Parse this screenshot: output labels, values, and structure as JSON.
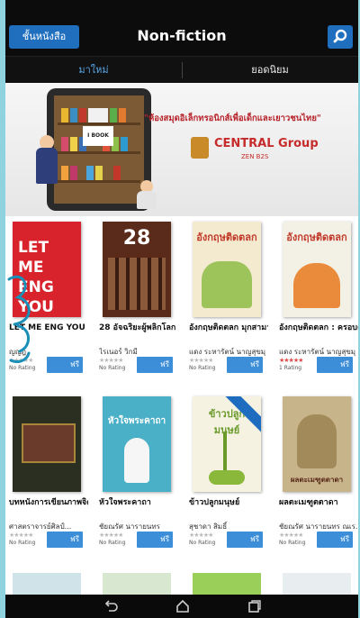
{
  "header": {
    "back_label": "ชั้นหนังสือ",
    "title": "Non-fiction",
    "search_icon": "search-icon"
  },
  "tabs": [
    {
      "label": "มาใหม่",
      "active": true
    },
    {
      "label": "ยอดนิยม",
      "active": false
    }
  ],
  "banner": {
    "book_badge": "I BOOK",
    "slogan": "\"ห้องสมุดอิเล็กทรอนิกส์เพื่อเด็กและเยาวชนไทย\"",
    "brand": "CENTRAL Group",
    "brand_sub": "ZEN B2S"
  },
  "books": [
    {
      "cover_text": "LET ME ENG YOU",
      "title": "LET ME ENG YOU",
      "author": "ญญฎ",
      "rating": "No Rating",
      "price": "ฟรี",
      "cover_color": "#d8232c"
    },
    {
      "cover_text": "28",
      "title": "28 อัจฉริยะผู้พลิกโลก",
      "author": "ไรเนอร์ วิกมี",
      "rating": "No Rating",
      "price": "ฟรี",
      "cover_color": "#5a2a1a"
    },
    {
      "cover_text": "อังกฤษติดตลก",
      "title": "อังกฤษติดตลก มุกสามานตาดชีพ",
      "author": "แดง ระหารัตน์ นาญสุขมุ",
      "rating": "No Rating",
      "price": "ฟรี",
      "cover_color": "#f4ead0"
    },
    {
      "cover_text": "อังกฤษติดตลก",
      "title": "อังกฤษติดตลก : ครอบครัวเฮฮา กัน...",
      "author": "แดง ระหารัตน์ นาญสุขมุ",
      "rating": "1 Rating",
      "price": "ฟรี",
      "cover_color": "#f3f0e6"
    },
    {
      "cover_text": "",
      "title": "บทหนังการเขียนภาพจิตรกรรมไทย...",
      "author": "ศาสตราจารย์ศิลป์...",
      "rating": "No Rating",
      "price": "ฟรี",
      "cover_color": "#2b2f22"
    },
    {
      "cover_text": "หัวใจพระคาถา",
      "title": "หัวใจพระคาถา",
      "author": "ชัยณรัศ นารายนทร",
      "rating": "No Rating",
      "price": "ฟรี",
      "cover_color": "#4ab0c8"
    },
    {
      "cover_text": "ข้าวปลูกมนุษย์",
      "title": "ข้าวปลูกมนุษย์",
      "author": "สุชาดา สิมธิ์",
      "rating": "No Rating",
      "price": "ฟรี",
      "cover_color": "#f5f2e2"
    },
    {
      "cover_text": "ผลตะเมฑูตตาดา",
      "title": "ผลตะเมฑูตตาดา",
      "author": "ชัยณรัศ นารายนทร ณเร...",
      "rating": "No Rating",
      "price": "ฟรี",
      "cover_color": "#c7b48a"
    }
  ],
  "navbar": {
    "back_icon": "back-icon",
    "home_icon": "home-icon",
    "recent_icon": "recent-apps-icon"
  }
}
